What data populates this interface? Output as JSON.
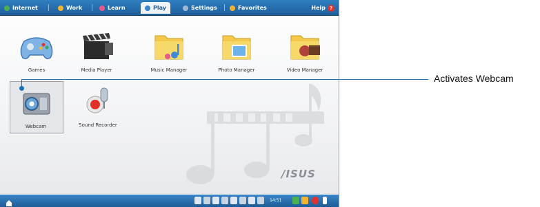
{
  "tabs": [
    {
      "label": "Internet",
      "icon": "globe-icon",
      "color": "#4caf50"
    },
    {
      "label": "Work",
      "icon": "briefcase-icon",
      "color": "#f2b233"
    },
    {
      "label": "Learn",
      "icon": "book-icon",
      "color": "#e85a8a"
    },
    {
      "label": "Play",
      "icon": "play-icon",
      "color": "#3a86c8"
    },
    {
      "label": "Settings",
      "icon": "wrench-icon",
      "color": "#9fb9d6"
    },
    {
      "label": "Favorites",
      "icon": "star-icon",
      "color": "#f2b233"
    }
  ],
  "active_tab": "Play",
  "help_label": "Help",
  "apps": [
    {
      "label": "Games",
      "icon": "gamepad-icon"
    },
    {
      "label": "Media Player",
      "icon": "clapperboard-icon"
    },
    {
      "label": "Music Manager",
      "icon": "music-folder-icon"
    },
    {
      "label": "Photo Manager",
      "icon": "photo-folder-icon"
    },
    {
      "label": "Video Manager",
      "icon": "video-folder-icon"
    },
    {
      "label": "Webcam",
      "icon": "webcam-icon"
    },
    {
      "label": "Sound Recorder",
      "icon": "microphone-icon"
    }
  ],
  "selected_app": "Webcam",
  "brand": "/ISUS",
  "callout": "Activates Webcam",
  "taskbar": {
    "clock": "14:51"
  }
}
